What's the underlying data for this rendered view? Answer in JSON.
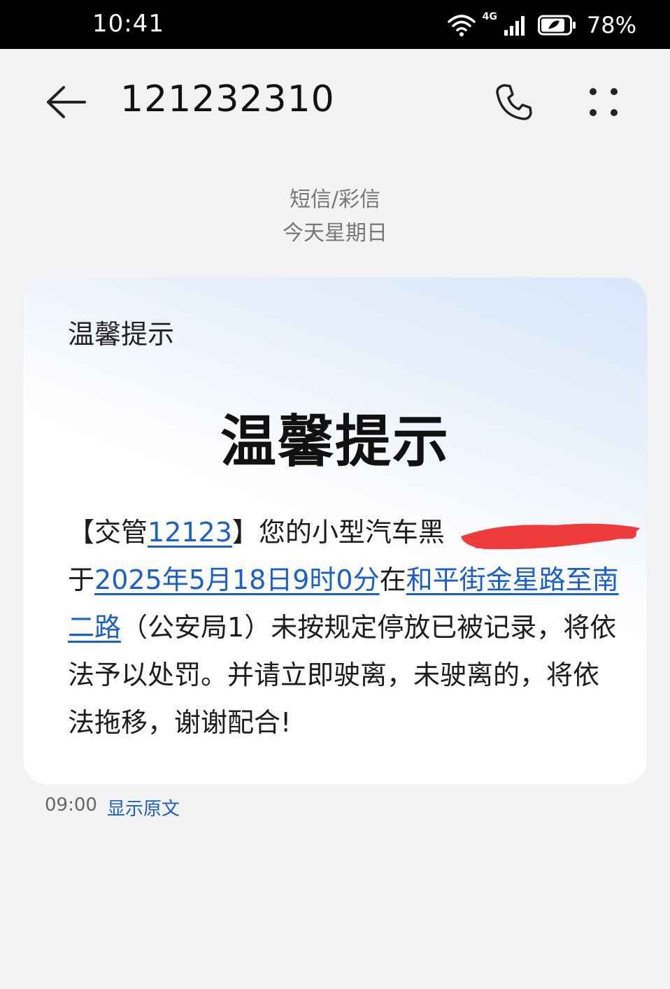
{
  "status_bar": {
    "time": "10:41",
    "network": "4G",
    "battery": "78%"
  },
  "header": {
    "title": "121232310",
    "back_icon": "back-arrow-icon",
    "call_icon": "phone-icon",
    "more_icon": "more-dots-icon"
  },
  "meta": {
    "type": "短信/彩信",
    "date": "今天星期日"
  },
  "card": {
    "label": "温馨提示",
    "heading": "温馨提示",
    "body": {
      "p1": "【交管",
      "link_12123": "12123",
      "p2": "】您的小型汽车黑",
      "p3": "于",
      "link_datetime": "2025年5月18日9时0分",
      "p4": "在",
      "link_location": "和平街金星路至南二路",
      "p5": "（公安局1）未按规定停放已被记录，将依法予以处罚。并请立即驶离，未驶离的，将依法拖移，谢谢配合!"
    }
  },
  "footer": {
    "time": "09:00",
    "show_original": "显示原文"
  },
  "colors": {
    "link": "#1d5fc8",
    "redaction": "#ef3b3b"
  }
}
